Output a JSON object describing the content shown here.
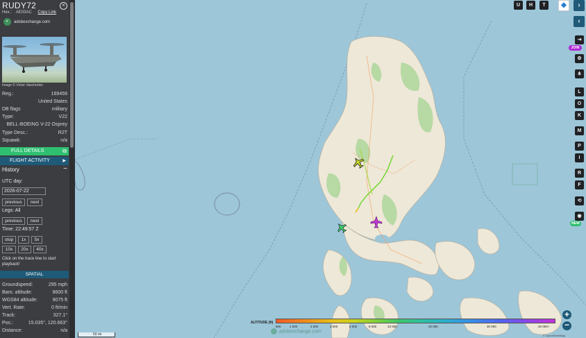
{
  "aircraft": {
    "callsign": "RUDY72",
    "hex_label": "Hex.:",
    "hex": "AE03AC",
    "copy_link": "Copy Link",
    "site_name": "adsbexchange.com",
    "photo_credit": "Image © Victor Vaschenko",
    "fields": [
      {
        "key": "Reg.:",
        "value": "169459"
      },
      {
        "key": "",
        "value": "United States"
      },
      {
        "key": "DB flags",
        "value": "military"
      },
      {
        "key": "Type:",
        "value": "V22"
      },
      {
        "key": "",
        "value": "BELL-BOEING V-22 Osprey"
      },
      {
        "key": "Type Desc.:",
        "value": "R2T"
      },
      {
        "key": "Squawk:",
        "value": "n/a"
      }
    ]
  },
  "sidebar": {
    "full_details": "FULL DETAILS",
    "flight_activity": "FLIGHT ACTIVITY",
    "history": "History",
    "utc_day_label": "UTC day:",
    "utc_day_value": "2026-07-22",
    "previous": "previous",
    "next": "next",
    "legs_label": "Legs: All",
    "time_label": "Time: 22:49:57 Z",
    "stop": "stop",
    "speed_buttons": [
      "1x",
      "5x",
      "10x",
      "20x",
      "40x"
    ],
    "playback_hint": "Click on the trace line to start playback!",
    "spatial": "SPATIAL",
    "spatial_fields": [
      {
        "key": "Groundspeed:",
        "value": "295 mph"
      },
      {
        "key": "Baro. altitude:",
        "value": "8600 ft"
      },
      {
        "key": "WGS84 altitude:",
        "value": "9075 ft"
      },
      {
        "key": "Vert. Rate:",
        "value": "0 ft/min"
      },
      {
        "key": "Track:",
        "value": "327.1°"
      },
      {
        "key": "Pos.:",
        "value": "15.035°, 120.663°"
      },
      {
        "key": "Distance:",
        "value": "n/a"
      }
    ]
  },
  "map": {
    "toolbar_top": [
      "U",
      "H",
      "T"
    ],
    "join_label": "JOIN",
    "new_label": "NEW",
    "toolbar_letters": [
      "L",
      "O",
      "K",
      "M",
      "P",
      "I",
      "R",
      "F"
    ],
    "scale_label": "50 mi",
    "watermark": "adsbexchange.com",
    "attribution": "© OpenStreetMap"
  },
  "altitude_legend": {
    "title": "ALTITUDE (ft)",
    "ticks": [
      "500",
      "1 000",
      "2 000",
      "4 000",
      "6 000",
      "8 000",
      "10 000",
      "20 000",
      "30 000",
      "40 000+"
    ]
  },
  "colors": {
    "sidebar_bg": "#3b3d41",
    "accent_green": "#2fbf71",
    "accent_blue": "#1f5a78",
    "sea": "#9dc6d8",
    "land": "#eee8d8"
  }
}
